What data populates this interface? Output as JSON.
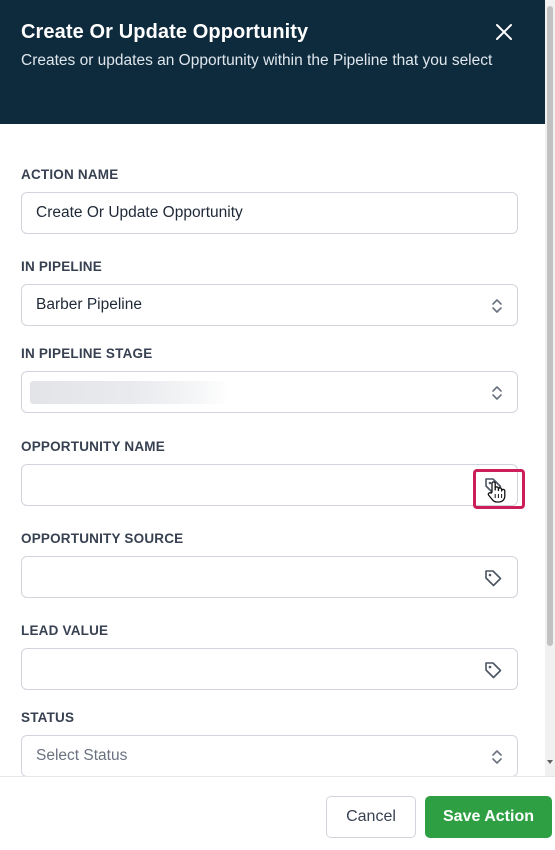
{
  "header": {
    "title": "Create Or Update Opportunity",
    "subtitle": "Creates or updates an Opportunity within the Pipeline that you select",
    "close_icon": "close-icon"
  },
  "fields": {
    "action_name": {
      "label": "ACTION NAME",
      "value": "Create Or Update Opportunity"
    },
    "in_pipeline": {
      "label": "IN PIPELINE",
      "value": "Barber Pipeline"
    },
    "in_pipeline_stage": {
      "label": "IN PIPELINE STAGE",
      "value": ""
    },
    "opportunity_name": {
      "label": "OPPORTUNITY NAME",
      "value": ""
    },
    "opportunity_source": {
      "label": "OPPORTUNITY SOURCE",
      "value": ""
    },
    "lead_value": {
      "label": "LEAD VALUE",
      "value": ""
    },
    "status": {
      "label": "STATUS",
      "placeholder": "Select Status"
    }
  },
  "footer": {
    "cancel_label": "Cancel",
    "save_label": "Save Action"
  },
  "colors": {
    "header_bg": "#0e2b3e",
    "save_bg": "#2ea043",
    "highlight": "#cc1f5a"
  }
}
